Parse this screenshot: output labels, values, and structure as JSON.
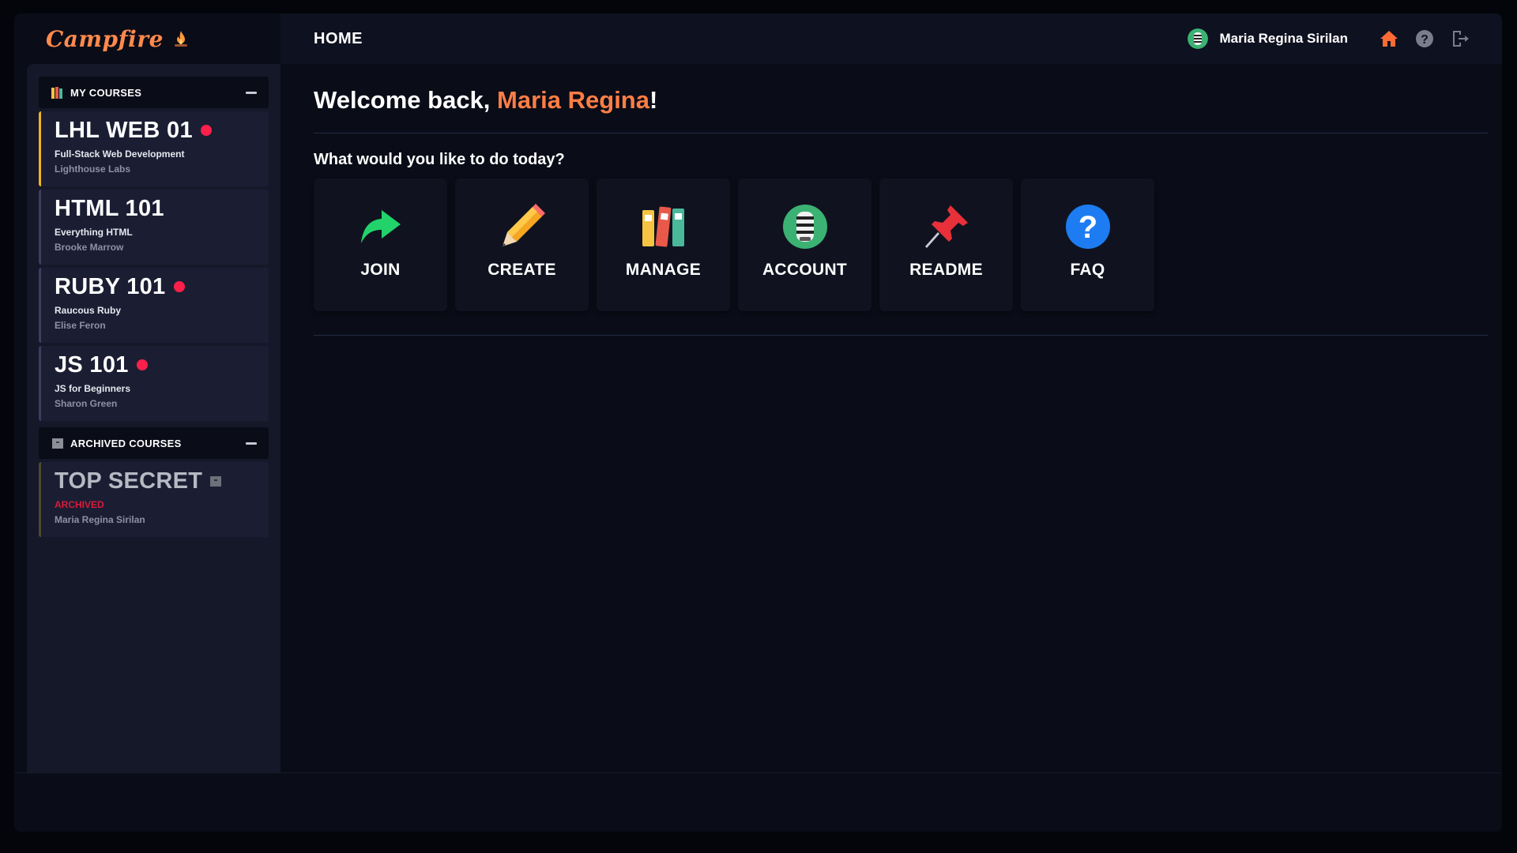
{
  "app": {
    "name": "Campfire"
  },
  "header": {
    "page_title": "HOME",
    "user_name": "Maria Regina Sirilan",
    "icons": [
      "zebra-avatar-icon",
      "home-icon",
      "help-icon",
      "logout-icon"
    ]
  },
  "sidebar": {
    "my_courses": {
      "title": "MY COURSES",
      "courses": [
        {
          "title": "LHL WEB 01",
          "description": "Full-Stack Web Development",
          "owner": "Lighthouse Labs",
          "notification": true,
          "active": true
        },
        {
          "title": "HTML 101",
          "description": "Everything HTML",
          "owner": "Brooke Marrow",
          "notification": false
        },
        {
          "title": "RUBY 101",
          "description": "Raucous Ruby",
          "owner": "Elise Feron",
          "notification": true
        },
        {
          "title": "JS 101",
          "description": "JS for Beginners",
          "owner": "Sharon Green",
          "notification": true
        }
      ]
    },
    "archived_courses": {
      "title": "ARCHIVED COURSES",
      "courses": [
        {
          "title": "TOP SECRET",
          "status": "ARCHIVED",
          "owner": "Maria Regina Sirilan"
        }
      ]
    }
  },
  "main": {
    "welcome_prefix": "Welcome back, ",
    "welcome_name": "Maria Regina",
    "welcome_suffix": "!",
    "prompt": "What would you like to do today?",
    "actions": [
      {
        "label": "JOIN",
        "icon": "share-arrow-icon"
      },
      {
        "label": "CREATE",
        "icon": "pencil-icon"
      },
      {
        "label": "MANAGE",
        "icon": "binders-icon"
      },
      {
        "label": "ACCOUNT",
        "icon": "zebra-icon"
      },
      {
        "label": "README",
        "icon": "pushpin-icon"
      },
      {
        "label": "FAQ",
        "icon": "question-icon"
      }
    ]
  },
  "colors": {
    "accent": "#ff7e45",
    "notification": "#ff1f4b",
    "active_course_border": "#f0b323",
    "archived_label": "#d61c3a"
  }
}
